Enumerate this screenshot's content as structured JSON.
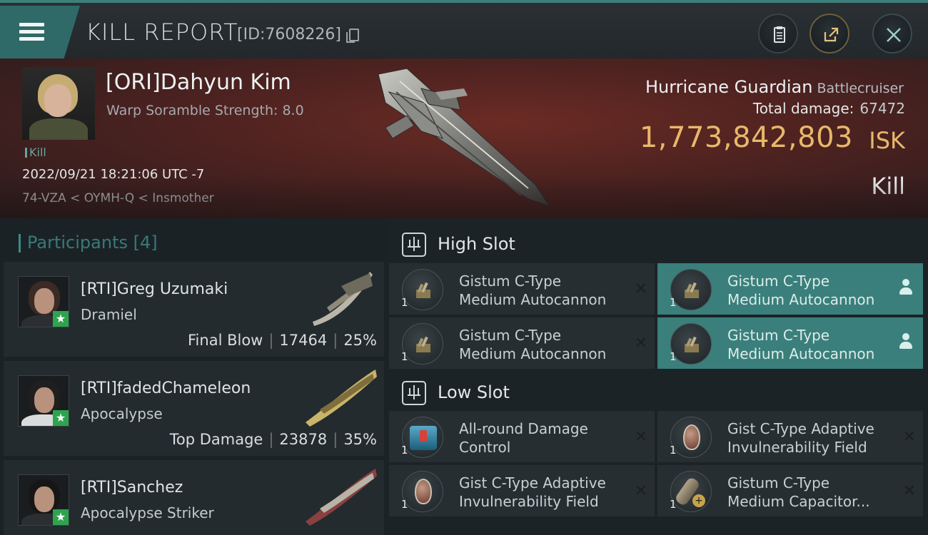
{
  "header": {
    "title": "KILL REPORT",
    "id_label": "[ID:7608226]"
  },
  "victim": {
    "name": "[ORI]Dahyun Kim",
    "warp": "Warp Soramble Strength: 8.0",
    "kill_tag": "Kill",
    "datetime": "2022/09/21 18:21:06 UTC -7",
    "location": "74-VZA < OYMH-Q < Insmother",
    "ship_name": "Hurricane Guardian",
    "ship_class": "Battlecruiser",
    "total_damage_label": "Total damage:",
    "total_damage": "67472",
    "isk_value": "1,773,842,803",
    "isk_unit": "ISK",
    "result": "Kill"
  },
  "participants": {
    "title": "Participants",
    "count": "[4]",
    "items": [
      {
        "name": "[RTI]Greg Uzumaki",
        "ship": "Dramiel",
        "tag": "Final Blow",
        "damage": "17464",
        "percent": "25%"
      },
      {
        "name": "[RTI]fadedChameleon",
        "ship": "Apocalypse",
        "tag": "Top Damage",
        "damage": "23878",
        "percent": "35%"
      },
      {
        "name": "[RTI]Sanchez",
        "ship": "Apocalypse Striker",
        "tag": "",
        "damage": "",
        "percent": ""
      }
    ]
  },
  "fitting": {
    "high_slot": {
      "title": "High Slot",
      "modules": [
        {
          "line1": "Gistum C-Type",
          "line2": "Medium Autocannon",
          "qty": "1"
        },
        {
          "line1": "Gistum C-Type",
          "line2": "Medium Autocannon",
          "qty": "1"
        },
        {
          "line1": "Gistum C-Type",
          "line2": "Medium Autocannon",
          "qty": "1"
        },
        {
          "line1": "Gistum C-Type",
          "line2": "Medium Autocannon",
          "qty": "1"
        }
      ]
    },
    "low_slot": {
      "title": "Low Slot",
      "modules": [
        {
          "line1": "All-round Damage",
          "line2": "Control",
          "qty": "1"
        },
        {
          "line1": "Gist C-Type Adaptive",
          "line2": "Invulnerability Field",
          "qty": "1"
        },
        {
          "line1": "Gist C-Type Adaptive",
          "line2": "Invulnerability Field",
          "qty": "1"
        },
        {
          "line1": "Gistum C-Type",
          "line2": "Medium Capacitor...",
          "qty": "1"
        }
      ]
    },
    "remove_symbol": "✕"
  },
  "colors": {
    "accent": "#3a7f7b",
    "isk": "#e8b86b",
    "corp_badge": "#2ea44f"
  },
  "icons": {
    "menu": "hamburger-icon",
    "copy": "copy-icon",
    "clipboard": "clipboard-icon",
    "share": "share-icon",
    "close": "close-icon",
    "slot": "slot-icon",
    "owner": "person-icon"
  }
}
